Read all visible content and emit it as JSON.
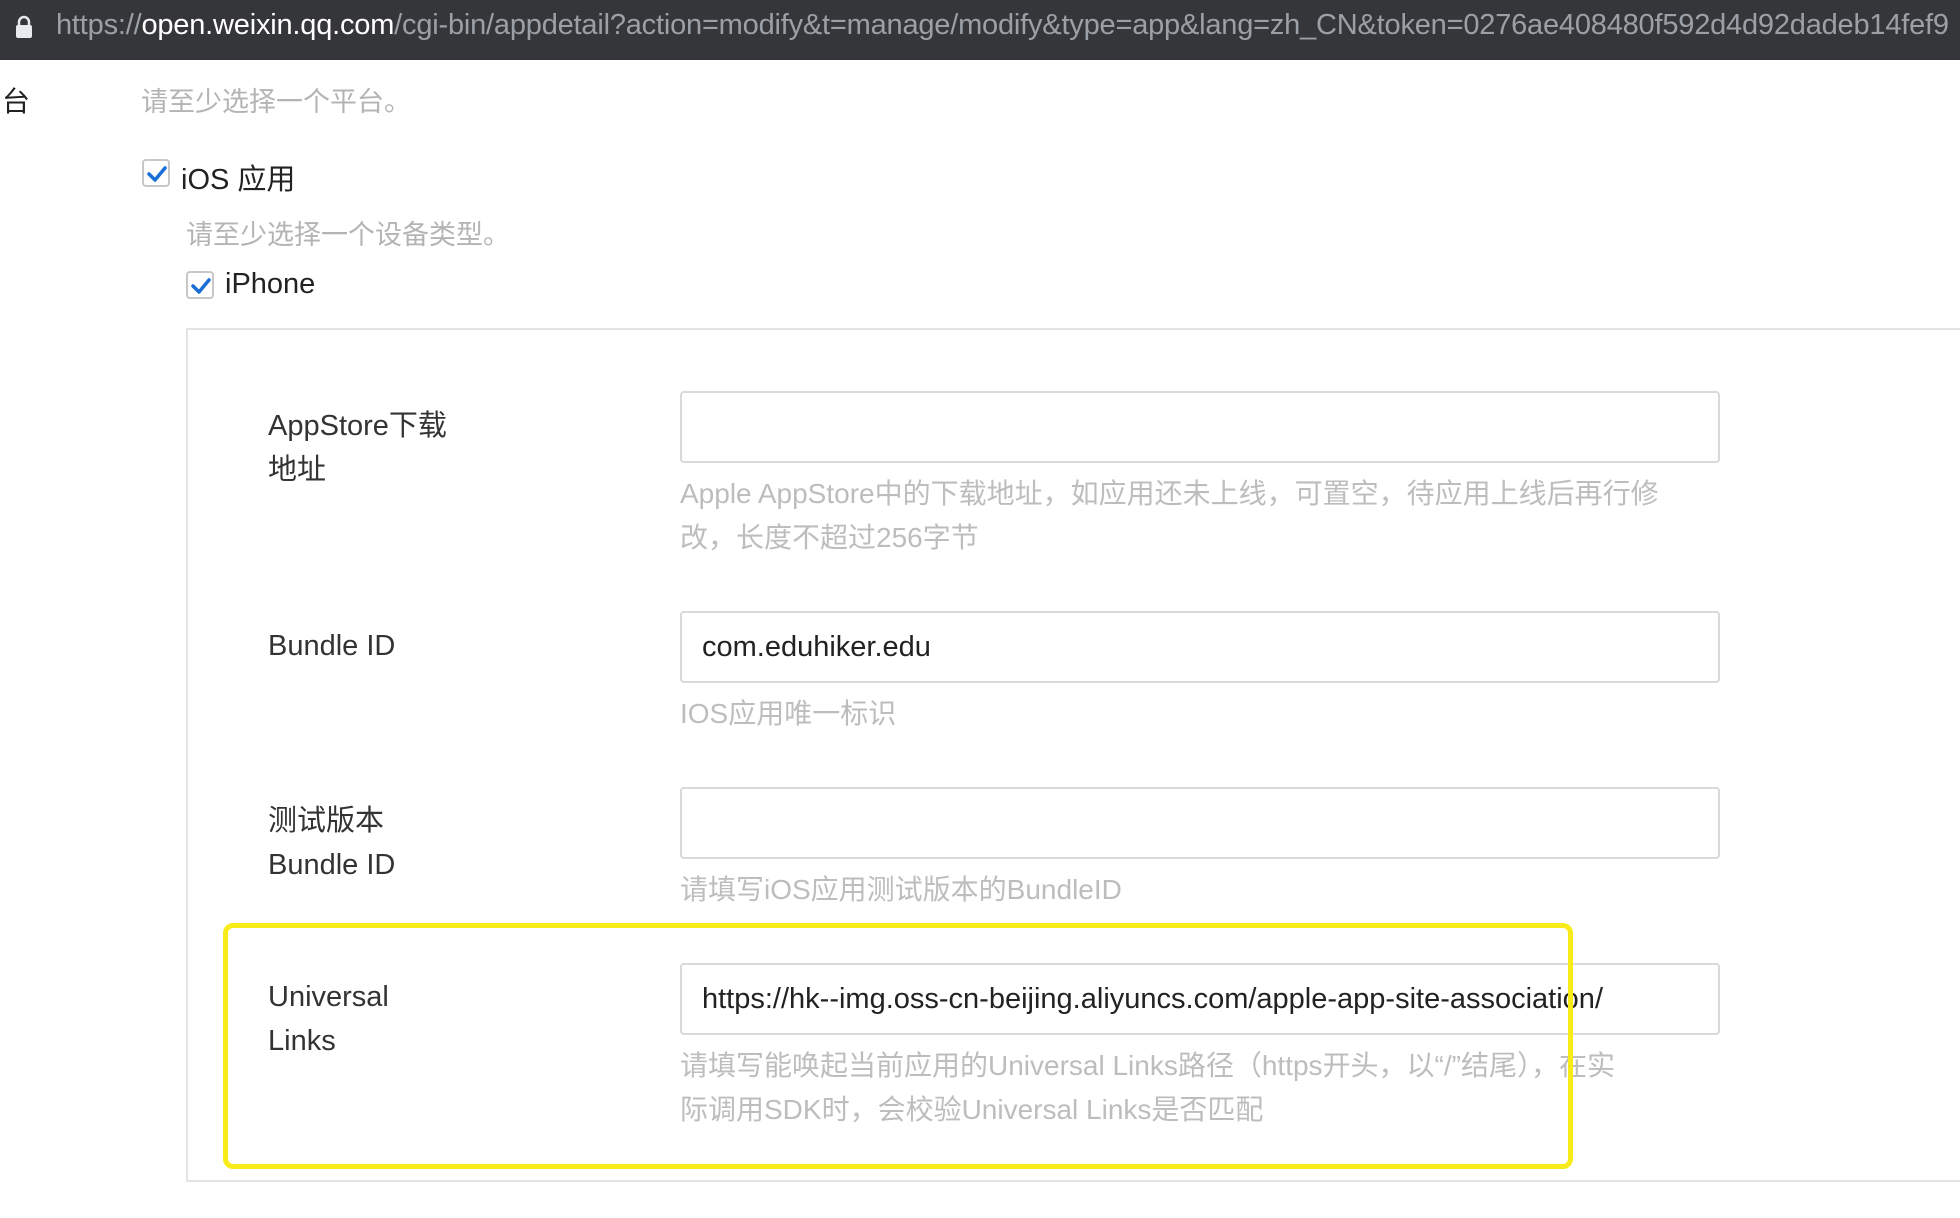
{
  "browser": {
    "url_scheme": "https://",
    "url_domain": "open.weixin.qq.com",
    "url_rest": "/cgi-bin/appdetail?action=modify&t=manage/modify&type=app&lang=zh_CN&token=0276ae408480f592d4d92dadeb14fef9"
  },
  "platform": {
    "side_label": "台",
    "hint": "请至少选择一个平台。",
    "ios_label": "iOS 应用",
    "ios_checked": true
  },
  "device": {
    "hint": "请至少选择一个设备类型。",
    "iphone_label": "iPhone",
    "iphone_checked": true
  },
  "form": {
    "appstore": {
      "label_line1": "AppStore下载",
      "label_line2": "地址",
      "value": "",
      "hint_line1": "Apple AppStore中的下载地址，如应用还未上线，可置空，待应用上线后再行修",
      "hint_line2": "改，长度不超过256字节"
    },
    "bundle_id": {
      "label": "Bundle ID",
      "value": "com.eduhiker.edu",
      "hint": "IOS应用唯一标识"
    },
    "test_bundle_id": {
      "label_line1": "测试版本",
      "label_line2": "Bundle ID",
      "value": "",
      "hint": "请填写iOS应用测试版本的BundleID"
    },
    "universal_links": {
      "label_line1": "Universal",
      "label_line2": "Links",
      "value": "https://hk--img.oss-cn-beijing.aliyuncs.com/apple-app-site-association/",
      "hint_line1": "请填写能唤起当前应用的Universal Links路径（https开头，以“/”结尾），在实",
      "hint_line2": "际调用SDK时，会校验Universal Links是否匹配"
    }
  },
  "colors": {
    "highlight": "#f7ec1a",
    "check": "#1a6fd6"
  }
}
